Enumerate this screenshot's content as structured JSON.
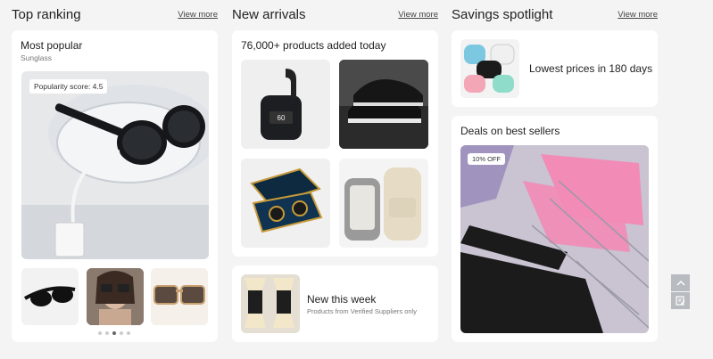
{
  "columns": {
    "top_ranking": {
      "title": "Top ranking",
      "view_more": "View more"
    },
    "new_arrivals": {
      "title": "New arrivals",
      "view_more": "View more"
    },
    "savings": {
      "title": "Savings spotlight",
      "view_more": "View more"
    }
  },
  "most_popular": {
    "title": "Most popular",
    "category": "Sunglass",
    "badge": "Popularity score: 4.5",
    "thumbnails": [
      "sunglasses-thumb-1",
      "sunglasses-thumb-2",
      "sunglasses-thumb-3"
    ],
    "carousel_active_index": 2,
    "carousel_count": 5
  },
  "arrivals": {
    "title": "76,000+ products added today",
    "products": [
      "earbuds",
      "black-sneakers",
      "earbuds-case",
      "backpack"
    ]
  },
  "new_this_week": {
    "title": "New this week",
    "subtitle": "Products from Verified Suppliers only"
  },
  "lowest_prices": {
    "title": "Lowest prices in 180 days"
  },
  "deals": {
    "title": "Deals on best sellers",
    "badge": "10% OFF"
  },
  "colors": {
    "accent": "#222222",
    "card_bg": "#ffffff",
    "page_bg": "#f4f4f4"
  }
}
